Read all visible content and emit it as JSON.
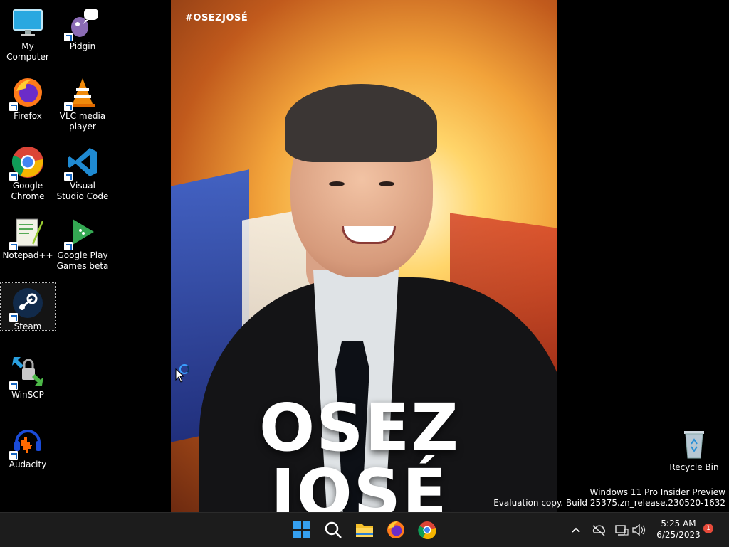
{
  "desktop": {
    "icons": [
      {
        "label": "My Computer",
        "icon": "monitor-icon"
      },
      {
        "label": "Pidgin",
        "icon": "pidgin-icon"
      },
      {
        "label": "Firefox",
        "icon": "firefox-icon"
      },
      {
        "label": "VLC media player",
        "icon": "vlc-icon"
      },
      {
        "label": "Google Chrome",
        "icon": "chrome-icon"
      },
      {
        "label": "Visual Studio Code",
        "icon": "vscode-icon"
      },
      {
        "label": "Notepad++",
        "icon": "notepadpp-icon"
      },
      {
        "label": "Google Play Games beta",
        "icon": "google-play-games-icon"
      },
      {
        "label": "Steam",
        "icon": "steam-icon"
      },
      {
        "label": "WinSCP",
        "icon": "winscp-icon"
      },
      {
        "label": "Audacity",
        "icon": "audacity-icon"
      }
    ],
    "recycle_bin": {
      "label": "Recycle Bin"
    }
  },
  "wallpaper": {
    "hashtag": "#OSEZJOSÉ",
    "line1": "OSEZ",
    "line2": "JOSÉ"
  },
  "watermark": {
    "line1": "Windows 11 Pro Insider Preview",
    "line2": "Evaluation copy. Build 25375.zn_release.230520-1632"
  },
  "taskbar": {
    "apps": [
      "start-icon",
      "search-icon",
      "file-explorer-icon",
      "firefox-icon",
      "chrome-icon"
    ],
    "clock": {
      "time": "5:25 AM",
      "date": "6/25/2023"
    },
    "notification_count": "1"
  }
}
